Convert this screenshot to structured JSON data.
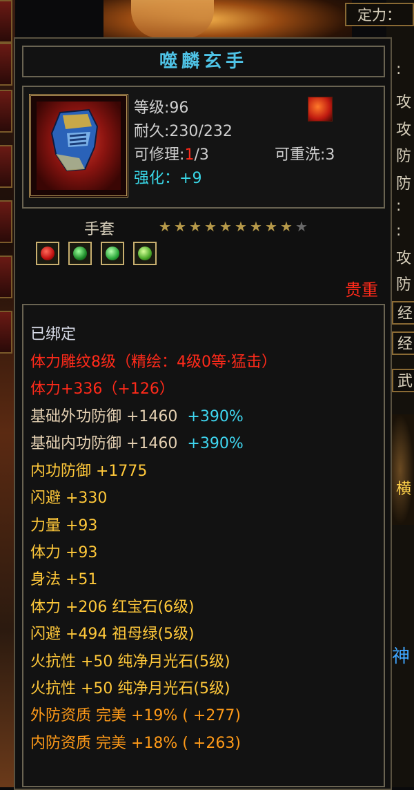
{
  "background": {
    "top_box_label": "定力：",
    "right_glyphs": [
      "攻",
      "攻",
      "防",
      "防",
      "攻",
      "防",
      "经",
      "经",
      "武",
      "横",
      "神"
    ],
    "right_colons": [
      ":",
      ":",
      ":",
      ":",
      ":"
    ]
  },
  "tooltip": {
    "title": "噬麟玄手",
    "level_label": "等级",
    "level_value": ":96",
    "durability_label": "耐久",
    "durability_value": ":230/232",
    "repair_label": "可修理",
    "repair_colon": ":",
    "repair_used": "1",
    "repair_max": "/3",
    "rewash_label": "可重洗",
    "rewash_value": ":3",
    "enhance_label": "强化：",
    "enhance_value": "+9",
    "item_type": "手套",
    "stars_filled": 9,
    "stars_total": 10,
    "gems": [
      "red-gem-icon",
      "green-gem-icon",
      "green-gem-icon",
      "green-gem-icon"
    ],
    "rarity": "贵重",
    "attributes": [
      {
        "text": "已绑定",
        "extra": "",
        "color": "c-white"
      },
      {
        "text": "体力雕纹8级（精绘：4级0等·猛击）",
        "extra": "",
        "color": "c-red"
      },
      {
        "text": "体力+336（+126）",
        "extra": "",
        "color": "c-red"
      },
      {
        "text": "基础外功防御  +1460",
        "extra": "+390%",
        "color": "c-beige"
      },
      {
        "text": "基础内功防御  +1460",
        "extra": "+390%",
        "color": "c-beige"
      },
      {
        "text": "内功防御  +1775",
        "extra": "",
        "color": "c-yellow"
      },
      {
        "text": "闪避  +330",
        "extra": "",
        "color": "c-yellow"
      },
      {
        "text": "力量  +93",
        "extra": "",
        "color": "c-yellow"
      },
      {
        "text": "体力  +93",
        "extra": "",
        "color": "c-yellow"
      },
      {
        "text": "身法  +51",
        "extra": "",
        "color": "c-yellow"
      },
      {
        "text": "体力  +206  红宝石(6级)",
        "extra": "",
        "color": "c-yellow"
      },
      {
        "text": "闪避  +494  祖母绿(5级)",
        "extra": "",
        "color": "c-yellow"
      },
      {
        "text": "火抗性  +50  纯净月光石(5级)",
        "extra": "",
        "color": "c-yellow"
      },
      {
        "text": "火抗性  +50  纯净月光石(5级)",
        "extra": "",
        "color": "c-yellow"
      },
      {
        "text": "外防资质   完美  +19%  (  +277)",
        "extra": "",
        "color": "c-orange"
      },
      {
        "text": "内防资质   完美  +18%  (  +263)",
        "extra": "",
        "color": "c-orange"
      }
    ]
  }
}
